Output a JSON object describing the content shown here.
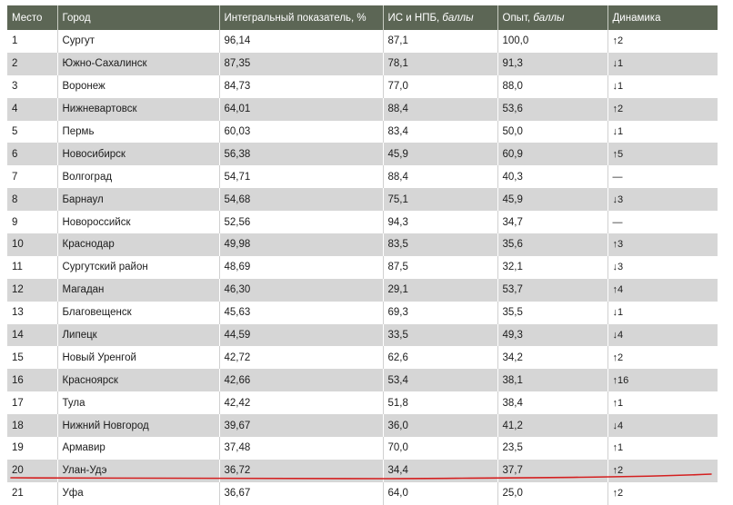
{
  "table": {
    "headers": {
      "rank": "Место",
      "city": "Город",
      "integral": "Интегральный показатель, %",
      "isnpb_prefix": "ИС и НПБ, ",
      "isnpb_unit": "баллы",
      "exp_prefix": "Опыт, ",
      "exp_unit": "баллы",
      "dynamics": "Динамика"
    },
    "rows": [
      {
        "rank": "1",
        "city": "Сургут",
        "integral": "96,14",
        "isnpb": "87,1",
        "exp": "100,0",
        "dyn": "↑2"
      },
      {
        "rank": "2",
        "city": "Южно-Сахалинск",
        "integral": "87,35",
        "isnpb": "78,1",
        "exp": "91,3",
        "dyn": "↓1"
      },
      {
        "rank": "3",
        "city": "Воронеж",
        "integral": "84,73",
        "isnpb": "77,0",
        "exp": "88,0",
        "dyn": "↓1"
      },
      {
        "rank": "4",
        "city": "Нижневартовск",
        "integral": "64,01",
        "isnpb": "88,4",
        "exp": "53,6",
        "dyn": "↑2"
      },
      {
        "rank": "5",
        "city": "Пермь",
        "integral": "60,03",
        "isnpb": "83,4",
        "exp": "50,0",
        "dyn": "↓1"
      },
      {
        "rank": "6",
        "city": "Новосибирск",
        "integral": "56,38",
        "isnpb": "45,9",
        "exp": "60,9",
        "dyn": "↑5"
      },
      {
        "rank": "7",
        "city": "Волгоград",
        "integral": "54,71",
        "isnpb": "88,4",
        "exp": "40,3",
        "dyn": "—"
      },
      {
        "rank": "8",
        "city": "Барнаул",
        "integral": "54,68",
        "isnpb": "75,1",
        "exp": "45,9",
        "dyn": "↓3"
      },
      {
        "rank": "9",
        "city": "Новороссийск",
        "integral": "52,56",
        "isnpb": "94,3",
        "exp": "34,7",
        "dyn": "—"
      },
      {
        "rank": "10",
        "city": "Краснодар",
        "integral": "49,98",
        "isnpb": "83,5",
        "exp": "35,6",
        "dyn": "↑3"
      },
      {
        "rank": "11",
        "city": "Сургутский район",
        "integral": "48,69",
        "isnpb": "87,5",
        "exp": "32,1",
        "dyn": "↓3"
      },
      {
        "rank": "12",
        "city": "Магадан",
        "integral": "46,30",
        "isnpb": "29,1",
        "exp": "53,7",
        "dyn": "↑4"
      },
      {
        "rank": "13",
        "city": "Благовещенск",
        "integral": "45,63",
        "isnpb": "69,3",
        "exp": "35,5",
        "dyn": "↓1"
      },
      {
        "rank": "14",
        "city": "Липецк",
        "integral": "44,59",
        "isnpb": "33,5",
        "exp": "49,3",
        "dyn": "↓4"
      },
      {
        "rank": "15",
        "city": "Новый Уренгой",
        "integral": "42,72",
        "isnpb": "62,6",
        "exp": "34,2",
        "dyn": "↑2"
      },
      {
        "rank": "16",
        "city": "Красноярск",
        "integral": "42,66",
        "isnpb": "53,4",
        "exp": "38,1",
        "dyn": "↑16"
      },
      {
        "rank": "17",
        "city": "Тула",
        "integral": "42,42",
        "isnpb": "51,8",
        "exp": "38,4",
        "dyn": "↑1"
      },
      {
        "rank": "18",
        "city": "Нижний Новгород",
        "integral": "39,67",
        "isnpb": "36,0",
        "exp": "41,2",
        "dyn": "↓4"
      },
      {
        "rank": "19",
        "city": "Армавир",
        "integral": "37,48",
        "isnpb": "70,0",
        "exp": "23,5",
        "dyn": "↑1"
      },
      {
        "rank": "20",
        "city": "Улан-Удэ",
        "integral": "36,72",
        "isnpb": "34,4",
        "exp": "37,7",
        "dyn": "↑2"
      },
      {
        "rank": "21",
        "city": "Уфа",
        "integral": "36,67",
        "isnpb": "64,0",
        "exp": "25,0",
        "dyn": "↑2"
      }
    ]
  },
  "highlight": {
    "row_rank": "20",
    "color": "#d42020"
  },
  "colors": {
    "header_bg": "#5c6655",
    "row_alt": "#d6d6d6"
  }
}
